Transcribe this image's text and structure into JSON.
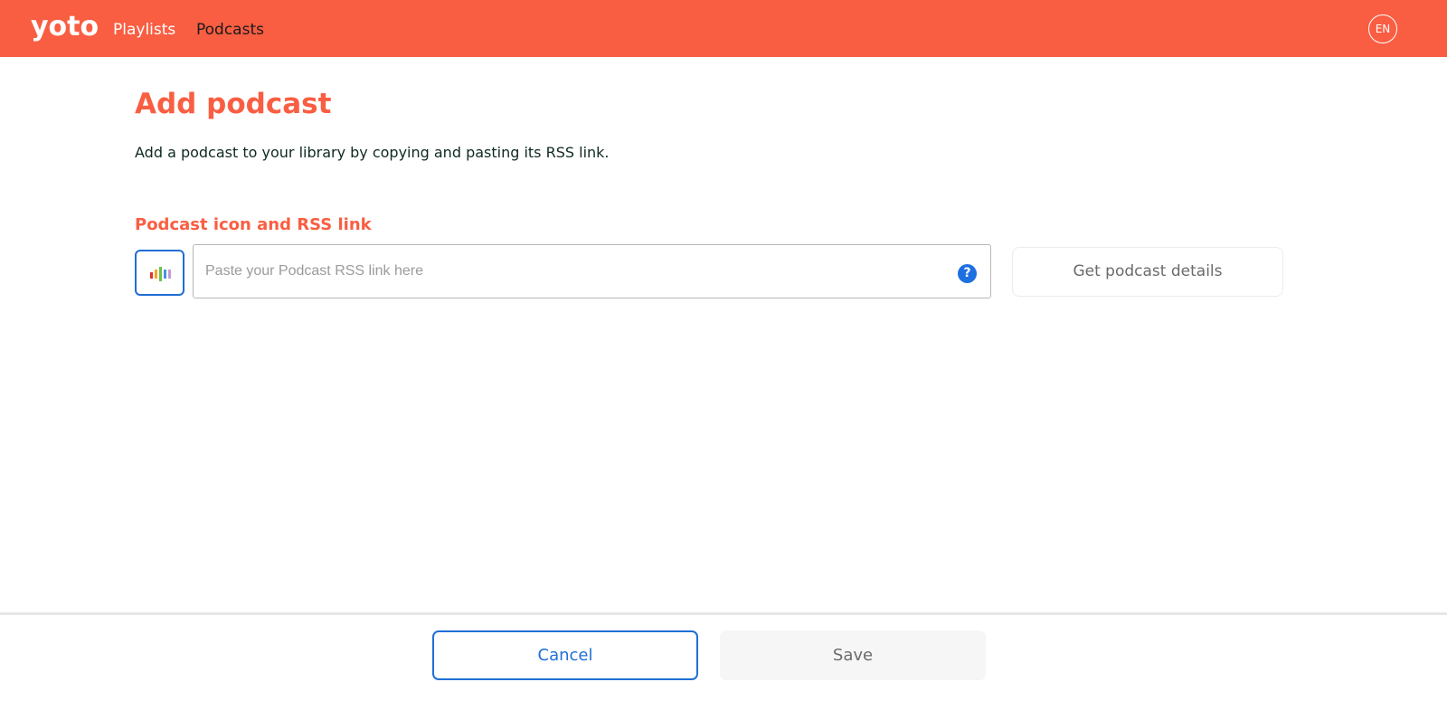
{
  "header": {
    "logo": "yoto",
    "nav": [
      {
        "label": "Playlists",
        "active": false
      },
      {
        "label": "Podcasts",
        "active": true
      }
    ],
    "language": "EN"
  },
  "main": {
    "title": "Add podcast",
    "intro": "Add a podcast to your library by copying and pasting its RSS link.",
    "section_label": "Podcast icon and RSS link",
    "icon_picker": {
      "icon": "audio-bars-icon"
    },
    "rss_input": {
      "placeholder": "Paste your Podcast RSS link here",
      "value": ""
    },
    "help": {
      "icon": "help-icon",
      "symbol": "?"
    },
    "get_details_label": "Get podcast details"
  },
  "footer": {
    "cancel_label": "Cancel",
    "save_label": "Save"
  },
  "colors": {
    "brand": "#f95e42",
    "accent_blue": "#1f6fd6",
    "help_blue": "#1e6fe0"
  }
}
